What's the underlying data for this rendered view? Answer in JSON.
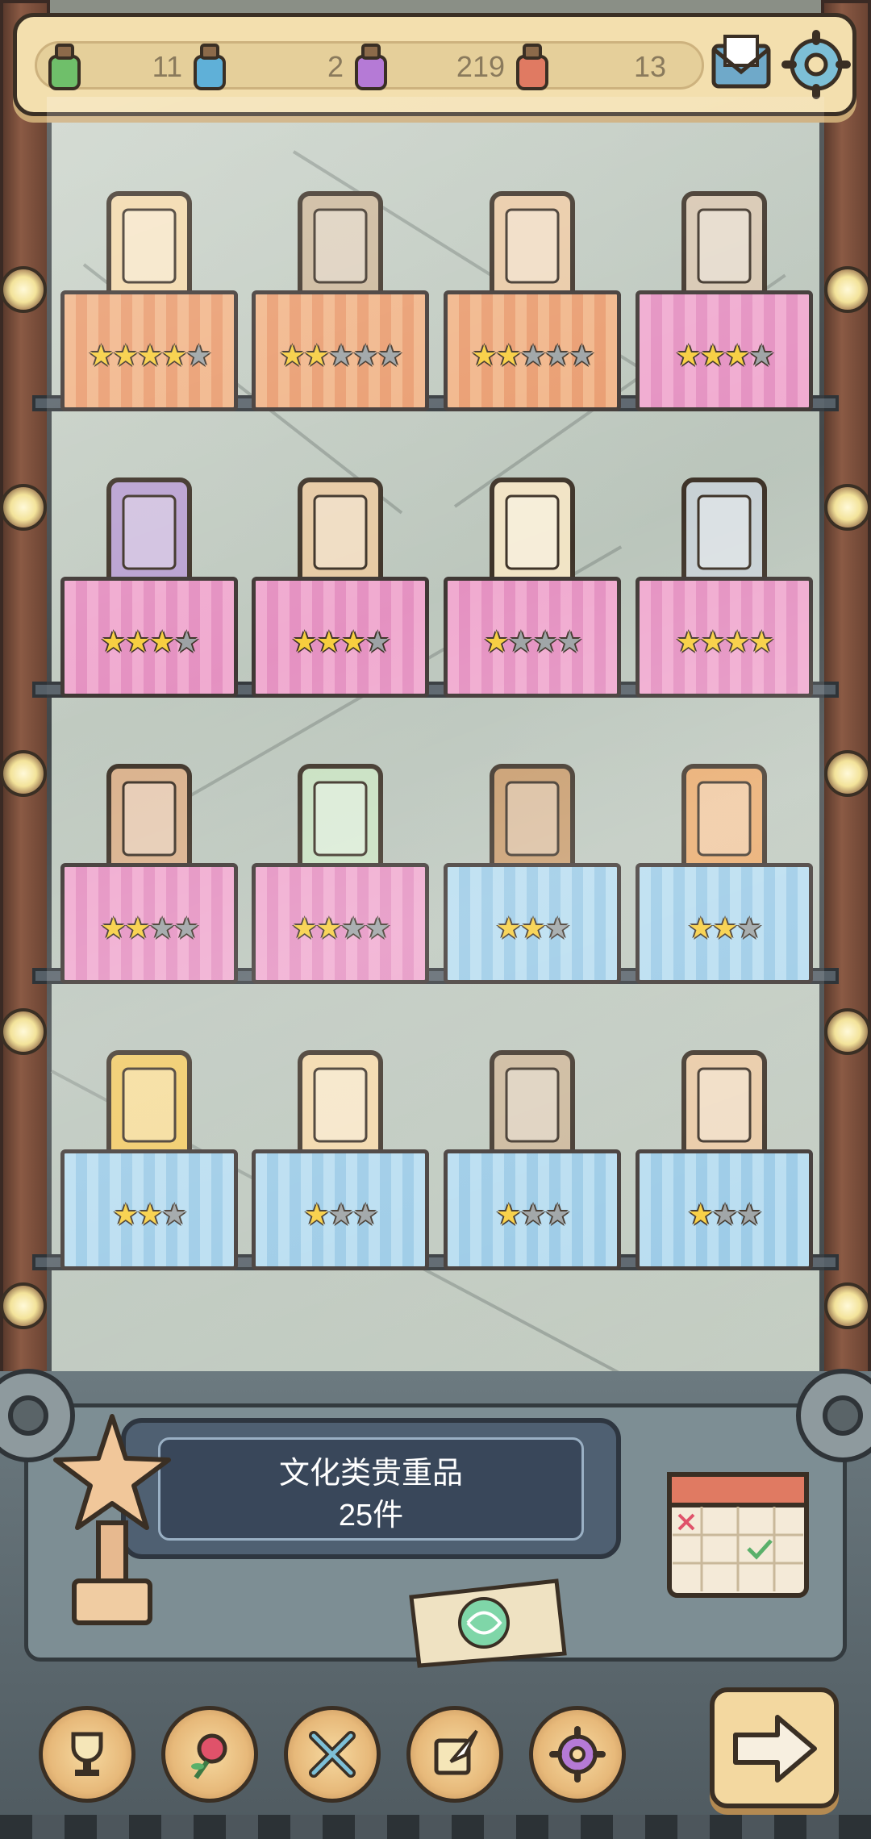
{
  "resources": [
    {
      "name": "green-ink",
      "count": "11",
      "color": "#6fbf6a"
    },
    {
      "name": "blue-ink",
      "count": "2",
      "color": "#5fb0d8"
    },
    {
      "name": "purple-ink",
      "count": "219",
      "color": "#b57ad6"
    },
    {
      "name": "red-ink",
      "count": "13",
      "color": "#e07a62"
    }
  ],
  "shelves": [
    [
      {
        "icon": "genji-book-icon",
        "stars": 4,
        "max": 5,
        "cloth": "orange"
      },
      {
        "icon": "stone-tablet-icon",
        "stars": 2,
        "max": 5,
        "cloth": "orange"
      },
      {
        "icon": "leaf-book-icon",
        "stars": 2,
        "max": 5,
        "cloth": "orange"
      },
      {
        "icon": "portrait-book-icon",
        "stars": 3,
        "max": 4,
        "cloth": "pink"
      }
    ],
    [
      {
        "icon": "herbal-book-icon",
        "stars": 3,
        "max": 4,
        "cloth": "pink"
      },
      {
        "icon": "purple-book-icon",
        "stars": 3,
        "max": 4,
        "cloth": "pink"
      },
      {
        "icon": "ancient-script-tablet-icon",
        "stars": 1,
        "max": 4,
        "cloth": "pink"
      },
      {
        "icon": "open-manuscript-icon",
        "stars": 4,
        "max": 4,
        "cloth": "pink"
      }
    ],
    [
      {
        "icon": "spinning-top-icon",
        "stars": 2,
        "max": 4,
        "cloth": "pink"
      },
      {
        "icon": "sutra-book-icon",
        "stars": 2,
        "max": 4,
        "cloth": "pink"
      },
      {
        "icon": "axe-stand-icon",
        "stars": 2,
        "max": 3,
        "cloth": "blue"
      },
      {
        "icon": "scroll-tools-icon",
        "stars": 2,
        "max": 3,
        "cloth": "blue"
      }
    ],
    [
      {
        "icon": "potted-plant-icon",
        "stars": 2,
        "max": 3,
        "cloth": "blue"
      },
      {
        "icon": "smoking-pipe-icon",
        "stars": 1,
        "max": 3,
        "cloth": "blue"
      },
      {
        "icon": "ornate-urn-icon",
        "stars": 1,
        "max": 3,
        "cloth": "blue"
      },
      {
        "icon": "pumpkin-carriage-icon",
        "stars": 1,
        "max": 3,
        "cloth": "blue"
      }
    ]
  ],
  "panel": {
    "title": "文化类贵重品",
    "count": "25件"
  },
  "nav": [
    {
      "name": "trophy-nav-button",
      "icon": "trophy-icon"
    },
    {
      "name": "rose-nav-button",
      "icon": "rose-icon"
    },
    {
      "name": "tools-nav-button",
      "icon": "crossed-tools-icon"
    },
    {
      "name": "quill-nav-button",
      "icon": "quill-scroll-icon"
    },
    {
      "name": "gear-nav-button",
      "icon": "gear-icon"
    }
  ],
  "colors": {
    "star_on": "#f7cd3a",
    "star_off": "#9aa0a2",
    "topbar": "#f3dfae"
  }
}
